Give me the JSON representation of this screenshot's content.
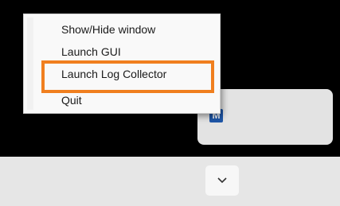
{
  "context_menu": {
    "items": [
      {
        "label": "Show/Hide window"
      },
      {
        "label": "Launch GUI"
      },
      {
        "label": "Launch Log Collector"
      },
      {
        "label": "Quit"
      }
    ]
  },
  "tray": {
    "app_icon": {
      "icon": "app-logo-icon",
      "letter": "M",
      "color": "#1f57a8"
    },
    "overflow_button": {
      "icon": "chevron-down-icon"
    }
  },
  "highlight": {
    "color": "#f07f1f",
    "target": "Launch Log Collector"
  }
}
